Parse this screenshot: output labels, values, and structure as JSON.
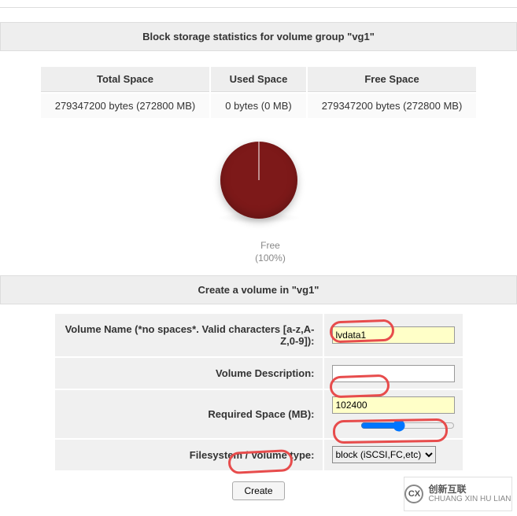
{
  "header": {
    "stats_title": "Block storage statistics for volume group \"vg1\""
  },
  "stats": {
    "cols": {
      "total": "Total Space",
      "used": "Used Space",
      "free": "Free Space"
    },
    "row": {
      "total": "279347200 bytes (272800 MB)",
      "used": "0 bytes (0 MB)",
      "free": "279347200 bytes (272800 MB)"
    }
  },
  "chart_data": {
    "type": "pie",
    "title": "",
    "series": [
      {
        "name": "Free",
        "value": 100,
        "color": "#7d1919"
      }
    ],
    "legend": {
      "label": "Free",
      "pct": "(100%)"
    }
  },
  "form_header": "Create a volume in \"vg1\"",
  "form": {
    "name_label": "Volume Name (*no spaces*. Valid characters [a-z,A-Z,0-9]):",
    "name_value": "lvdata1",
    "desc_label": "Volume Description:",
    "desc_value": "",
    "space_label": "Required Space (MB):",
    "space_value": "102400",
    "fs_label": "Filesystem / Volume type:",
    "fs_selected": "block (iSCSI,FC,etc)",
    "create_btn": "Create"
  },
  "watermark": {
    "cn": "创新互联",
    "en": "CHUANG XIN HU LIAN",
    "logo": "CX"
  }
}
